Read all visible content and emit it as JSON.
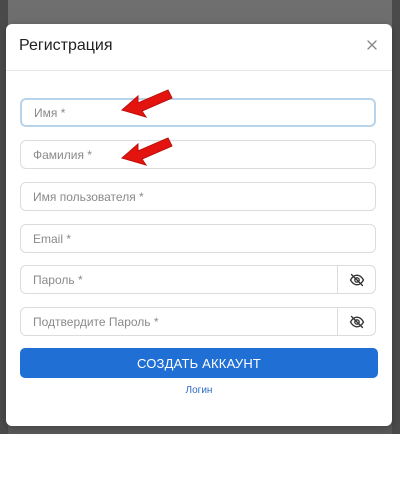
{
  "modal": {
    "title": "Регистрация",
    "close_icon": "close-icon"
  },
  "form": {
    "first_name_placeholder": "Имя *",
    "last_name_placeholder": "Фамилия *",
    "username_placeholder": "Имя пользователя *",
    "email_placeholder": "Email *",
    "password_placeholder": "Пароль *",
    "confirm_password_placeholder": "Подтвердите Пароль *",
    "eye_icon": "eye-off-icon"
  },
  "actions": {
    "submit_label": "СОЗДАТЬ АККАУНТ",
    "login_link": "Логин"
  },
  "colors": {
    "primary": "#1f6fd4",
    "annotation_arrow": "#e3140f",
    "focus_border": "#b8d4ec"
  }
}
